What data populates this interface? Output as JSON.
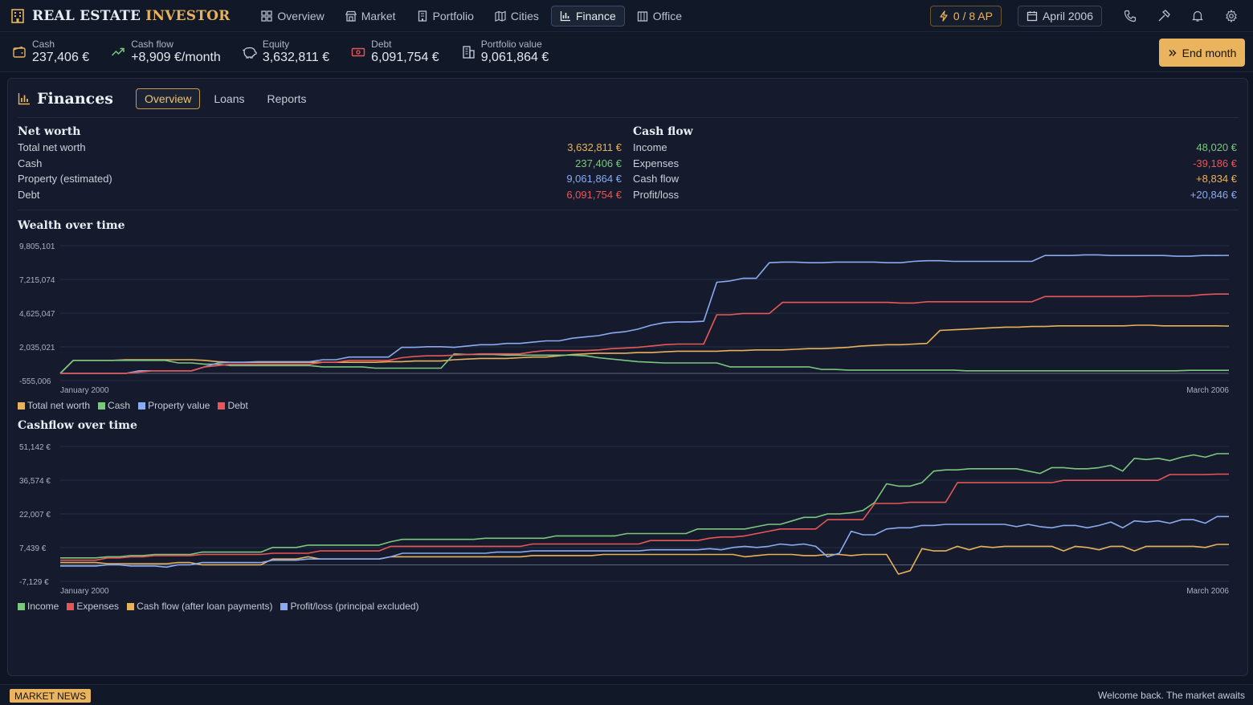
{
  "app": {
    "title_a": "REAL ESTATE",
    "title_b": "INVESTOR"
  },
  "nav": {
    "tabs": [
      {
        "label": "Overview",
        "icon": "grid-icon"
      },
      {
        "label": "Market",
        "icon": "store-icon"
      },
      {
        "label": "Portfolio",
        "icon": "building-icon"
      },
      {
        "label": "Cities",
        "icon": "map-icon"
      },
      {
        "label": "Finance",
        "icon": "chart-icon",
        "active": true
      },
      {
        "label": "Office",
        "icon": "office-icon"
      }
    ],
    "ap": "0 / 8 AP",
    "date": "April 2006"
  },
  "stats": {
    "cash": {
      "label": "Cash",
      "value": "237,406 €"
    },
    "cashflow": {
      "label": "Cash flow",
      "value": "+8,909 €/month"
    },
    "equity": {
      "label": "Equity",
      "value": "3,632,811 €"
    },
    "debt": {
      "label": "Debt",
      "value": "6,091,754 €"
    },
    "portfolio": {
      "label": "Portfolio value",
      "value": "9,061,864 €"
    },
    "end_month": "End month"
  },
  "finances": {
    "title": "Finances",
    "tabs": [
      "Overview",
      "Loans",
      "Reports"
    ],
    "networth": {
      "heading": "Net worth",
      "rows": [
        {
          "label": "Total net worth",
          "value": "3,632,811 €"
        },
        {
          "label": "Cash",
          "value": "237,406 €"
        },
        {
          "label": "Property (estimated)",
          "value": "9,061,864 €"
        },
        {
          "label": "Debt",
          "value": "6,091,754 €"
        }
      ]
    },
    "cashflow": {
      "heading": "Cash flow",
      "rows": [
        {
          "label": "Income",
          "value": "48,020 €"
        },
        {
          "label": "Expenses",
          "value": "-39,186 €"
        },
        {
          "label": "Cash flow",
          "value": "+8,834 €"
        },
        {
          "label": "Profit/loss",
          "value": "+20,846 €"
        }
      ]
    }
  },
  "colors": {
    "gold": "#e8b25a",
    "green": "#7cc77f",
    "blue": "#8aaaf2",
    "red": "#e85757"
  },
  "chart_data": [
    {
      "type": "line",
      "title": "Wealth over time",
      "yticks": [
        "9,805,101",
        "7,215,074",
        "4,625,047",
        "2,035,021",
        "-555,006"
      ],
      "ylim": [
        -555006,
        9805101
      ],
      "x_start": "January 2000",
      "x_end": "March 2006",
      "grid": true,
      "legend": "bottom-left",
      "series": [
        {
          "name": "Total net worth",
          "color": "#e8b25a",
          "values": [
            0,
            1000000,
            1000000,
            1000000,
            1000000,
            1050000,
            1050000,
            1050000,
            1050000,
            1050000,
            1050000,
            1000000,
            900000,
            850000,
            850000,
            850000,
            850000,
            850000,
            850000,
            850000,
            850000,
            850000,
            850000,
            850000,
            850000,
            900000,
            900000,
            950000,
            950000,
            950000,
            1050000,
            1100000,
            1150000,
            1150000,
            1150000,
            1200000,
            1250000,
            1250000,
            1350000,
            1450000,
            1500000,
            1550000,
            1550000,
            1550000,
            1600000,
            1600000,
            1650000,
            1700000,
            1700000,
            1700000,
            1700000,
            1750000,
            1750000,
            1800000,
            1800000,
            1800000,
            1850000,
            1900000,
            1900000,
            1950000,
            2000000,
            2100000,
            2150000,
            2200000,
            2200000,
            2250000,
            2300000,
            3300000,
            3350000,
            3400000,
            3450000,
            3500000,
            3550000,
            3550000,
            3600000,
            3600000,
            3650000,
            3650000,
            3650000,
            3650000,
            3650000,
            3650000,
            3700000,
            3700000,
            3650000,
            3650000,
            3650000,
            3650000,
            3650000,
            3632811
          ]
        },
        {
          "name": "Cash",
          "color": "#7cc77f",
          "values": [
            0,
            1000000,
            1000000,
            1000000,
            1000000,
            1000000,
            1000000,
            1000000,
            1000000,
            800000,
            800000,
            700000,
            700000,
            600000,
            600000,
            600000,
            600000,
            600000,
            600000,
            600000,
            500000,
            500000,
            500000,
            500000,
            400000,
            400000,
            400000,
            400000,
            400000,
            400000,
            1500000,
            1450000,
            1450000,
            1450000,
            1400000,
            1400000,
            1400000,
            1400000,
            1400000,
            1400000,
            1350000,
            1200000,
            1100000,
            1000000,
            900000,
            850000,
            800000,
            800000,
            800000,
            800000,
            800000,
            500000,
            500000,
            500000,
            500000,
            500000,
            500000,
            500000,
            300000,
            300000,
            250000,
            250000,
            250000,
            250000,
            250000,
            250000,
            250000,
            250000,
            250000,
            200000,
            200000,
            200000,
            200000,
            200000,
            200000,
            200000,
            200000,
            200000,
            200000,
            200000,
            200000,
            200000,
            200000,
            200000,
            200000,
            200000,
            237406,
            237406,
            237406,
            237406
          ]
        },
        {
          "name": "Property value",
          "color": "#8aaaf2",
          "values": [
            0,
            0,
            0,
            0,
            0,
            0,
            200000,
            200000,
            200000,
            200000,
            200000,
            500000,
            800000,
            850000,
            850000,
            900000,
            900000,
            900000,
            900000,
            900000,
            1050000,
            1050000,
            1250000,
            1250000,
            1250000,
            1250000,
            2000000,
            2000000,
            2050000,
            2050000,
            2000000,
            2100000,
            2200000,
            2200000,
            2300000,
            2300000,
            2400000,
            2500000,
            2500000,
            2700000,
            2800000,
            2900000,
            3100000,
            3200000,
            3400000,
            3700000,
            3900000,
            3950000,
            3950000,
            4000000,
            7000000,
            7100000,
            7300000,
            7300000,
            8500000,
            8550000,
            8550000,
            8500000,
            8500000,
            8550000,
            8550000,
            8550000,
            8550000,
            8500000,
            8500000,
            8600000,
            8650000,
            8650000,
            8600000,
            8600000,
            8600000,
            8600000,
            8600000,
            8600000,
            8600000,
            9050000,
            9050000,
            9050000,
            9100000,
            9100000,
            9050000,
            9050000,
            9050000,
            9050000,
            9050000,
            9000000,
            9000000,
            9050000,
            9050000,
            9061864
          ]
        },
        {
          "name": "Debt",
          "color": "#e85757",
          "values": [
            0,
            0,
            0,
            0,
            0,
            0,
            100000,
            200000,
            200000,
            200000,
            200000,
            500000,
            600000,
            700000,
            700000,
            700000,
            700000,
            700000,
            700000,
            700000,
            850000,
            850000,
            1000000,
            1000000,
            1000000,
            1000000,
            1200000,
            1300000,
            1350000,
            1350000,
            1400000,
            1450000,
            1500000,
            1500000,
            1500000,
            1500000,
            1650000,
            1750000,
            1750000,
            1750000,
            1750000,
            1800000,
            1900000,
            1950000,
            2000000,
            2100000,
            2200000,
            2250000,
            2250000,
            2250000,
            4500000,
            4500000,
            4600000,
            4600000,
            4600000,
            5450000,
            5450000,
            5450000,
            5450000,
            5450000,
            5450000,
            5450000,
            5450000,
            5450000,
            5400000,
            5400000,
            5500000,
            5500000,
            5500000,
            5500000,
            5500000,
            5500000,
            5500000,
            5500000,
            5500000,
            5900000,
            5900000,
            5900000,
            5900000,
            5900000,
            5900000,
            5900000,
            5900000,
            5950000,
            5950000,
            5950000,
            5950000,
            6050000,
            6091754,
            6091754
          ]
        }
      ]
    },
    {
      "type": "line",
      "title": "Cashflow over time",
      "yticks": [
        "51,142 €",
        "36,574 €",
        "22,007 €",
        "7,439 €",
        "-7,129 €"
      ],
      "ylim": [
        -7129,
        51142
      ],
      "x_start": "January 2000",
      "x_end": "March 2006",
      "grid": true,
      "legend": "bottom-left",
      "series": [
        {
          "name": "Income",
          "color": "#7cc77f",
          "values": [
            3000,
            3000,
            3000,
            3000,
            3500,
            3500,
            4000,
            4000,
            4500,
            4500,
            4500,
            4500,
            5500,
            5500,
            5500,
            5500,
            5500,
            5500,
            7500,
            7500,
            7500,
            8500,
            8500,
            8500,
            8500,
            8500,
            8500,
            8500,
            10000,
            11000,
            11000,
            11000,
            11000,
            11000,
            11000,
            11000,
            11500,
            11500,
            11500,
            11500,
            11500,
            11500,
            12500,
            12500,
            12500,
            12500,
            12500,
            12500,
            13500,
            13500,
            13500,
            13500,
            13500,
            13500,
            15500,
            15500,
            15500,
            15500,
            15500,
            16500,
            17500,
            17500,
            19000,
            20500,
            20500,
            22000,
            22000,
            22500,
            23500,
            27000,
            35000,
            34000,
            34000,
            35500,
            40500,
            41000,
            41000,
            41500,
            41500,
            41500,
            41500,
            41500,
            40500,
            39500,
            42000,
            42000,
            41500,
            41500,
            42000,
            43000,
            40500,
            46000,
            45500,
            46000,
            45000,
            46500,
            47500,
            46500,
            48020,
            48020
          ]
        },
        {
          "name": "Expenses",
          "color": "#e85757",
          "values": [
            2000,
            2000,
            2000,
            2000,
            3000,
            3000,
            3500,
            3500,
            4000,
            4000,
            4000,
            4000,
            4500,
            4500,
            4500,
            4500,
            4500,
            4500,
            5000,
            5000,
            5000,
            5000,
            6000,
            6000,
            6000,
            6000,
            6000,
            6000,
            8000,
            8000,
            8000,
            8000,
            8000,
            8000,
            8000,
            8000,
            8000,
            8000,
            8000,
            8000,
            9000,
            9000,
            9000,
            9000,
            9000,
            9000,
            9000,
            9000,
            9000,
            9000,
            10500,
            10500,
            10500,
            10500,
            10500,
            11500,
            12000,
            12000,
            12500,
            13500,
            14500,
            15500,
            15500,
            15500,
            15500,
            19500,
            19500,
            19500,
            19500,
            26500,
            26500,
            26500,
            27000,
            27000,
            27000,
            27000,
            35500,
            35500,
            35500,
            35500,
            35500,
            35500,
            35500,
            35500,
            35500,
            36500,
            36500,
            36500,
            36500,
            36500,
            36500,
            36500,
            36500,
            36500,
            39000,
            39000,
            39000,
            39000,
            39186,
            39186
          ]
        },
        {
          "name": "Cash flow (after loan payments)",
          "color": "#e8b25a",
          "values": [
            1000,
            1000,
            1000,
            1000,
            500,
            500,
            500,
            500,
            500,
            500,
            1000,
            1000,
            0,
            0,
            0,
            0,
            0,
            0,
            2500,
            2500,
            2500,
            3500,
            2500,
            2500,
            2500,
            2500,
            2500,
            2500,
            3500,
            3500,
            3500,
            3500,
            3500,
            3500,
            3500,
            3500,
            3500,
            3500,
            3500,
            3500,
            4000,
            4000,
            4000,
            4000,
            4000,
            4000,
            4500,
            4500,
            4500,
            4500,
            4500,
            4500,
            4500,
            4500,
            4500,
            4500,
            4500,
            4500,
            3500,
            4000,
            4500,
            4500,
            4500,
            4000,
            4000,
            4500,
            4500,
            4000,
            4500,
            4500,
            4500,
            -4000,
            -2500,
            7000,
            6000,
            6000,
            8000,
            6500,
            8000,
            7500,
            8000,
            8000,
            8000,
            8000,
            8000,
            6000,
            8000,
            7500,
            6500,
            8000,
            8000,
            6000,
            8000,
            8000,
            8000,
            8000,
            8000,
            7500,
            8834,
            8834
          ]
        },
        {
          "name": "Profit/loss (principal excluded)",
          "color": "#8aaaf2",
          "values": [
            -500,
            -500,
            -500,
            -500,
            0,
            0,
            -500,
            -500,
            -500,
            -1000,
            0,
            0,
            1000,
            1000,
            1000,
            1000,
            1000,
            1000,
            2000,
            2000,
            2000,
            2500,
            2500,
            2500,
            2500,
            2500,
            2500,
            2500,
            3500,
            5000,
            5000,
            5000,
            5000,
            5000,
            5000,
            5000,
            5000,
            5500,
            5500,
            5500,
            6000,
            6000,
            6000,
            6000,
            6000,
            6000,
            6000,
            6000,
            6000,
            6000,
            6500,
            6500,
            6500,
            6500,
            6500,
            7000,
            6500,
            7500,
            8000,
            7500,
            8000,
            9000,
            8500,
            9000,
            8000,
            3500,
            5000,
            14500,
            13000,
            13000,
            15500,
            16000,
            16000,
            17000,
            17000,
            17500,
            17500,
            17500,
            17500,
            17500,
            17500,
            16500,
            17500,
            16500,
            16000,
            17000,
            17000,
            16000,
            17000,
            18500,
            16000,
            19000,
            18500,
            19000,
            18000,
            19500,
            19500,
            18000,
            20846,
            20846
          ]
        }
      ]
    }
  ],
  "footer": {
    "badge": "MARKET NEWS",
    "ticker": "Welcome back. The market awaits"
  }
}
